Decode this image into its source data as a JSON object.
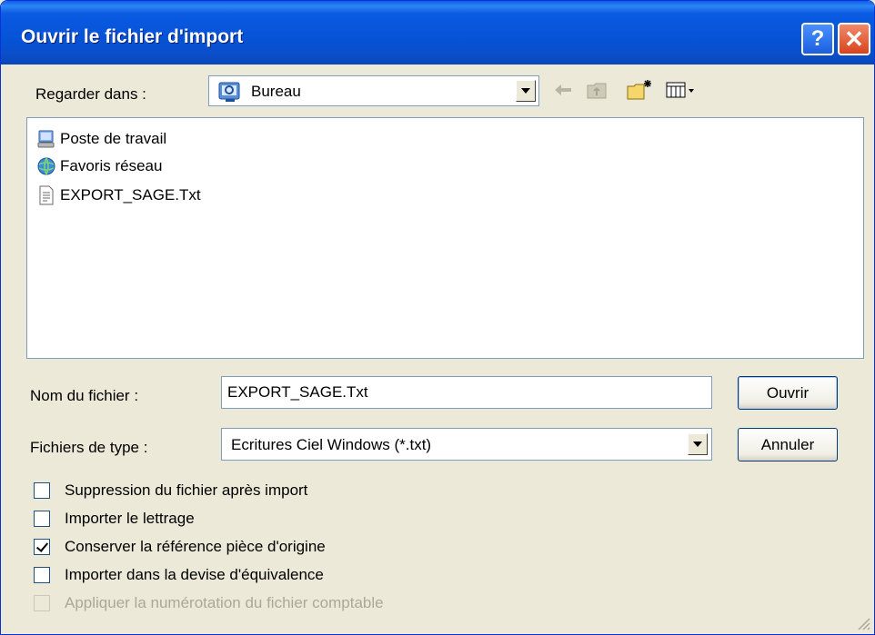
{
  "window": {
    "title": "Ouvrir le fichier d'import",
    "help_label": "?",
    "close_label": "✕"
  },
  "look_in": {
    "label": "Regarder dans :",
    "value": "Bureau"
  },
  "files": [
    {
      "name": "Poste de travail",
      "icon": "my-computer-icon"
    },
    {
      "name": "Favoris réseau",
      "icon": "network-places-icon"
    },
    {
      "name": "EXPORT_SAGE.Txt",
      "icon": "text-file-icon"
    }
  ],
  "filename": {
    "label": "Nom du fichier :",
    "value": "EXPORT_SAGE.Txt"
  },
  "filetype": {
    "label": "Fichiers de type :",
    "value": "Ecritures Ciel Windows (*.txt)"
  },
  "buttons": {
    "open": "Ouvrir",
    "cancel": "Annuler"
  },
  "options": [
    {
      "label": "Suppression du fichier après import",
      "checked": false,
      "enabled": true
    },
    {
      "label": "Importer le lettrage",
      "checked": false,
      "enabled": true
    },
    {
      "label": "Conserver la référence pièce d'origine",
      "checked": true,
      "enabled": true
    },
    {
      "label": "Importer dans la devise d'équivalence",
      "checked": false,
      "enabled": true
    },
    {
      "label": "Appliquer la numérotation du fichier comptable",
      "checked": false,
      "enabled": false
    }
  ],
  "colors": {
    "titlebar": "#0553d6",
    "dialog_bg": "#ece9d8",
    "close_button": "#d9431c"
  }
}
